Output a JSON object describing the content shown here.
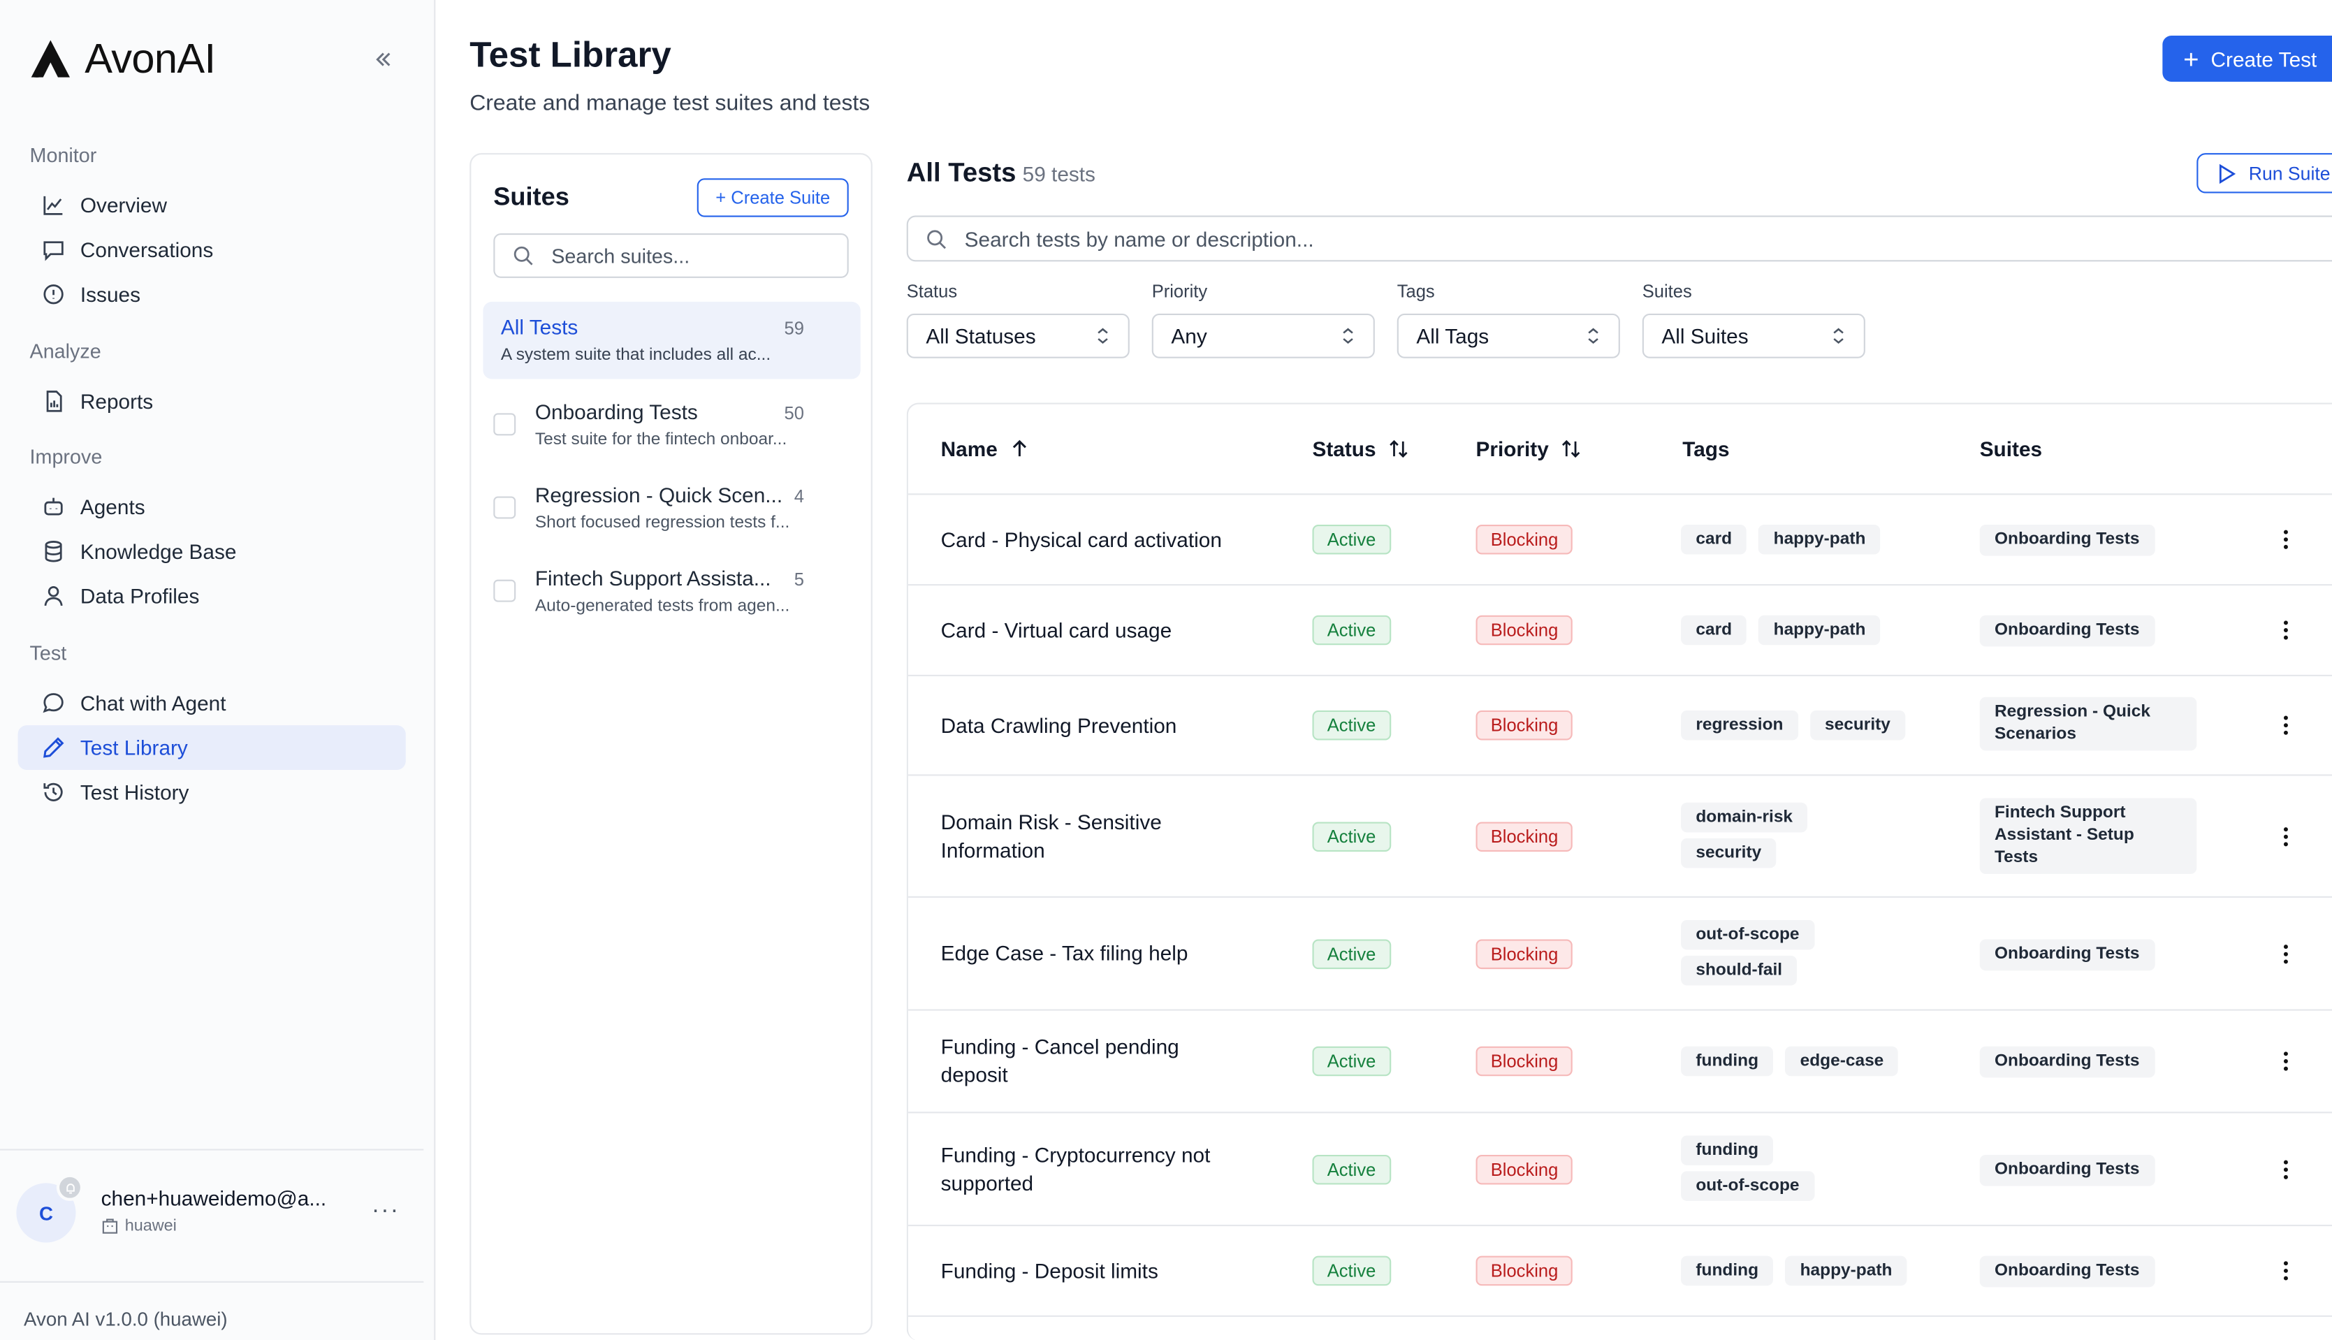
{
  "app": {
    "logo_text": "AvonAI",
    "version": "Avon AI v1.0.0 (huawei)"
  },
  "sidebar": {
    "sections": [
      {
        "heading": "Monitor",
        "items": [
          {
            "label": "Overview"
          },
          {
            "label": "Conversations"
          },
          {
            "label": "Issues"
          }
        ]
      },
      {
        "heading": "Analyze",
        "items": [
          {
            "label": "Reports"
          }
        ]
      },
      {
        "heading": "Improve",
        "items": [
          {
            "label": "Agents"
          },
          {
            "label": "Knowledge Base"
          },
          {
            "label": "Data Profiles"
          }
        ]
      },
      {
        "heading": "Test",
        "items": [
          {
            "label": "Chat with Agent"
          },
          {
            "label": "Test Library"
          },
          {
            "label": "Test History"
          }
        ]
      }
    ],
    "user": {
      "initial": "C",
      "email": "chen+huaweidemo@a...",
      "org": "huawei",
      "more": "···"
    }
  },
  "page": {
    "title": "Test Library",
    "subtitle": "Create and manage test suites and tests",
    "create_test_label": "Create Test"
  },
  "suites": {
    "title": "Suites",
    "create_label": "+ Create Suite",
    "search_placeholder": "Search suites...",
    "items": [
      {
        "name": "All Tests",
        "count": "59",
        "desc": "A system suite that includes all ac..."
      },
      {
        "name": "Onboarding Tests",
        "count": "50",
        "desc": "Test suite for the fintech onboar..."
      },
      {
        "name": "Regression - Quick Scen...",
        "count": "4",
        "desc": "Short focused regression tests f..."
      },
      {
        "name": "Fintech Support Assista...",
        "count": "5",
        "desc": "Auto-generated tests from agen..."
      }
    ]
  },
  "tests": {
    "title": "All Tests",
    "count": "59 tests",
    "run_suite_label": "Run Suite",
    "search_placeholder": "Search tests by name or description...",
    "filters": [
      {
        "label": "Status",
        "value": "All Statuses"
      },
      {
        "label": "Priority",
        "value": "Any"
      },
      {
        "label": "Tags",
        "value": "All Tags"
      },
      {
        "label": "Suites",
        "value": "All Suites"
      }
    ],
    "columns": {
      "name": "Name",
      "status": "Status",
      "priority": "Priority",
      "tags": "Tags",
      "suites": "Suites"
    },
    "rows": [
      {
        "name": "Card - Physical card activation",
        "status": "Active",
        "priority": "Blocking",
        "tags": [
          "card",
          "happy-path"
        ],
        "suite": "Onboarding Tests"
      },
      {
        "name": "Card - Virtual card usage",
        "status": "Active",
        "priority": "Blocking",
        "tags": [
          "card",
          "happy-path"
        ],
        "suite": "Onboarding Tests"
      },
      {
        "name": "Data Crawling Prevention",
        "status": "Active",
        "priority": "Blocking",
        "tags": [
          "regression",
          "security"
        ],
        "suite": "Regression - Quick Scenarios"
      },
      {
        "name": "Domain Risk - Sensitive Information",
        "status": "Active",
        "priority": "Blocking",
        "tags": [
          "domain-risk",
          "security"
        ],
        "suite": "Fintech Support Assistant - Setup Tests"
      },
      {
        "name": "Edge Case - Tax filing help",
        "status": "Active",
        "priority": "Blocking",
        "tags": [
          "out-of-scope",
          "should-fail"
        ],
        "suite": "Onboarding Tests"
      },
      {
        "name": "Funding - Cancel pending deposit",
        "status": "Active",
        "priority": "Blocking",
        "tags": [
          "funding",
          "edge-case"
        ],
        "suite": "Onboarding Tests"
      },
      {
        "name": "Funding - Cryptocurrency not supported",
        "status": "Active",
        "priority": "Blocking",
        "tags": [
          "funding",
          "out-of-scope"
        ],
        "suite": "Onboarding Tests"
      },
      {
        "name": "Funding - Deposit limits",
        "status": "Active",
        "priority": "Blocking",
        "tags": [
          "funding",
          "happy-path"
        ],
        "suite": "Onboarding Tests"
      }
    ]
  }
}
